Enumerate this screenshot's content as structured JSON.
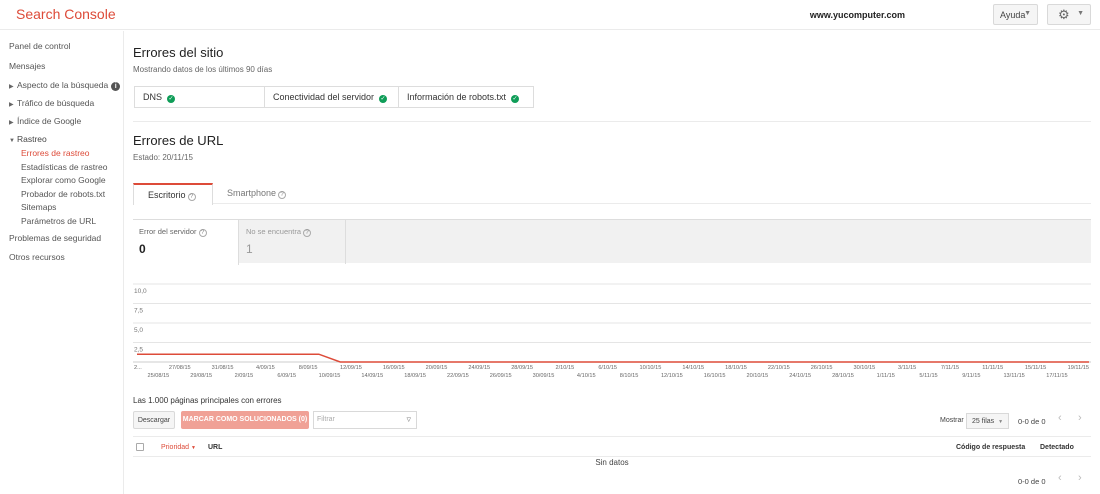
{
  "header": {
    "logo": "Search Console",
    "site": "www.yucomputer.com",
    "help_label": "Ayuda",
    "help_caret": "▼",
    "settings_icon": "gear-icon",
    "settings_caret": "▼"
  },
  "sidebar": {
    "items": [
      {
        "label": "Panel de control"
      },
      {
        "label": "Mensajes"
      },
      {
        "label": "Aspecto de la búsqueda",
        "arrow": "▶"
      },
      {
        "label": "Tráfico de búsqueda",
        "arrow": "▶"
      },
      {
        "label": "Índice de Google",
        "arrow": "▶"
      },
      {
        "label": "Rastreo",
        "arrow": "▼"
      },
      {
        "label": "Errores de rastreo"
      },
      {
        "label": "Estadísticas de rastreo"
      },
      {
        "label": "Explorar como Google"
      },
      {
        "label": "Probador de robots.txt"
      },
      {
        "label": "Sitemaps"
      },
      {
        "label": "Parámetros de URL"
      },
      {
        "label": "Problemas de seguridad"
      },
      {
        "label": "Otros recursos"
      }
    ]
  },
  "site_errors": {
    "title": "Errores del sitio",
    "subtitle": "Mostrando datos de los últimos 90 días",
    "checks": [
      {
        "label": "DNS",
        "status": "ok"
      },
      {
        "label": "Conectividad del servidor",
        "status": "ok"
      },
      {
        "label": "Información de robots.txt",
        "status": "ok"
      }
    ],
    "ok_glyph": "✓",
    "ok_color": "#0f9d58"
  },
  "url_errors": {
    "title": "Errores de URL",
    "status": "Estado: 20/11/15",
    "tabs": [
      {
        "label": "Escritorio",
        "active": true
      },
      {
        "label": "Smartphone",
        "active": false
      }
    ],
    "help_glyph": "?",
    "metrics": [
      {
        "label": "Error del servidor",
        "value": "0",
        "selected": true
      },
      {
        "label": "No se encuentra",
        "value": "1",
        "selected": false
      }
    ]
  },
  "chart_data": {
    "type": "line",
    "y_ticks": [
      "10,0",
      "7,5",
      "5,0",
      "2,5"
    ],
    "ylim": [
      0,
      10
    ],
    "x_start_label": "2...",
    "x_labels_top": [
      "27/08/15",
      "31/08/15",
      "4/09/15",
      "8/09/15",
      "12/09/15",
      "16/09/15",
      "20/09/15",
      "24/09/15",
      "28/09/15",
      "2/10/15",
      "6/10/15",
      "10/10/15",
      "14/10/15",
      "18/10/15",
      "22/10/15",
      "26/10/15",
      "30/10/15",
      "3/11/15",
      "7/11/15",
      "11/11/15",
      "15/11/15",
      "19/11/15"
    ],
    "x_labels_bottom": [
      "25/08/15",
      "29/08/15",
      "2/09/15",
      "6/09/15",
      "10/09/15",
      "14/09/15",
      "18/09/15",
      "22/09/15",
      "26/09/15",
      "30/09/15",
      "4/10/15",
      "8/10/15",
      "12/10/15",
      "16/10/15",
      "20/10/15",
      "24/10/15",
      "28/10/15",
      "1/11/15",
      "5/11/15",
      "9/11/15",
      "13/11/15",
      "17/11/15"
    ],
    "series": [
      {
        "color": "#dd4b39",
        "points": [
          [
            "23/08/15",
            1
          ],
          [
            "9/09/15",
            1
          ],
          [
            "11/09/15",
            0
          ],
          [
            "20/11/15",
            0
          ]
        ]
      }
    ],
    "grid": true
  },
  "table": {
    "title": "Las 1.000 páginas principales con errores",
    "download_label": "Descargar",
    "mark_fixed_label": "MARCAR COMO SOLUCIONADOS (0)",
    "mark_color": "#f0a196",
    "filter_placeholder": "Filtrar",
    "filter_icon": "funnel-icon",
    "show_label": "Mostrar",
    "rows_option": "25 filas",
    "rows_caret": "▼",
    "pager_text": "0-0 de 0",
    "prev_glyph": "‹",
    "next_glyph": "›",
    "columns": {
      "priority": "Prioridad",
      "priority_caret": "▼",
      "url": "URL",
      "response_code": "Código de respuesta",
      "detected": "Detectado"
    },
    "empty_text": "Sin datos"
  }
}
